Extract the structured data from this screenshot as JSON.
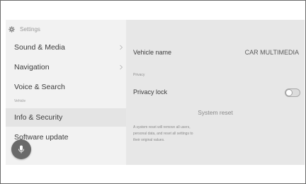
{
  "sidebar": {
    "header": {
      "label": "Settings",
      "icon": "gear-icon"
    },
    "items": [
      {
        "label": "Sound & Media",
        "chevron": true
      },
      {
        "label": "Navigation",
        "chevron": true
      },
      {
        "label": "Voice & Search",
        "chevron": false
      },
      {
        "label": "Info & Security",
        "chevron": false,
        "active": true
      },
      {
        "label": "Software update",
        "chevron": false
      }
    ],
    "section_vehicle": "Vehicle",
    "mic_icon": "microphone-icon"
  },
  "content": {
    "vehicle_name_label": "Vehicle name",
    "vehicle_name_value": "CAR MULTIMEDIA",
    "privacy_section": "Privacy",
    "privacy_lock_label": "Privacy lock",
    "privacy_lock_on": false,
    "system_reset_label": "System reset",
    "system_reset_desc_lines": [
      "A system reset will remove all users,",
      "personal data, and reset all settings to",
      "their original values."
    ]
  },
  "colors": {
    "sidebar_bg": "#f2f2f2",
    "content_bg": "#e7e7e7",
    "active_item_bg": "#e4e4e4",
    "mic_button": "#6a6a6a"
  }
}
